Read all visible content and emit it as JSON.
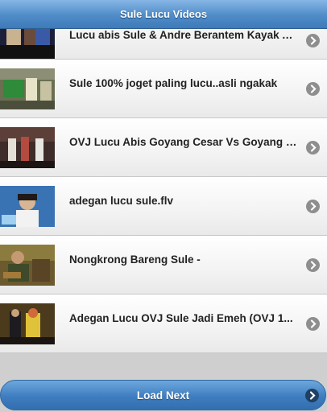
{
  "header": {
    "title": "Sule Lucu Videos"
  },
  "videos": [
    {
      "title": "Lucu abis Sule & Andre Berantem Kayak Anak Kecil"
    },
    {
      "title": "Sule 100% joget paling lucu..asli ngakak"
    },
    {
      "title": "OVJ Lucu Abis Goyang Cesar Vs Goyang Caisar"
    },
    {
      "title": "adegan lucu sule.flv"
    },
    {
      "title": "Nongkrong Bareng Sule -"
    },
    {
      "title": "Adegan Lucu OVJ Sule Jadi Emeh (OVJ 1..."
    }
  ],
  "footer": {
    "load_next_label": "Load Next"
  },
  "icons": {
    "row_arrow": "chevron-right-icon",
    "load_arrow": "chevron-right-icon"
  },
  "colors": {
    "header": "#4f8cc8",
    "button": "#3e7dc0",
    "background": "#cfcfcf"
  }
}
